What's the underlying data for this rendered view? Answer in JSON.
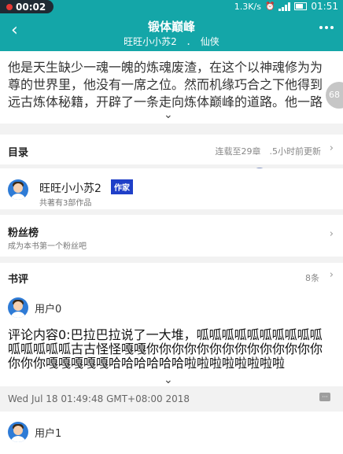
{
  "status_bar": {
    "time": "00:02",
    "net_speed": "1.3K/s",
    "clock": "01:51"
  },
  "app_bar": {
    "title": "锻体巅峰",
    "subtitle": "旺旺小小苏2　．　仙侠"
  },
  "intro": {
    "text": "他是天生缺少一魂一魄的炼魂废渣，在这个以神魂修为为尊的世界里，他没有一席之位。然而机缘巧合之下他得到远古炼体秘籍，开辟了一条走向炼体巅峰的道路。他一路",
    "float_badge": "68"
  },
  "catalog": {
    "title": "目录",
    "update_info": "连载至29章　.5小时前更新"
  },
  "author": {
    "name": "旺旺小小苏2",
    "badge": "作家",
    "works": "共著有3部作品"
  },
  "fans": {
    "title": "粉丝榜",
    "subtitle": "成为本书第一个粉丝吧"
  },
  "reviews": {
    "title": "书评",
    "count": "8条",
    "items": [
      {
        "user": "用户0",
        "content": "评论内容0:巴拉巴拉说了一大堆，呱呱呱呱呱呱呱呱呱呱呱呱呱呱呱古古怪怪嘎嘎你你你你你你你你你你你你你你你你你嘎嘎嘎嘎嘎哈哈哈哈哈哈啦啦啦啦啦啦啦啦",
        "date": "Wed Jul 18 01:49:48 GMT+08:00 2018"
      },
      {
        "user": "用户1"
      }
    ]
  }
}
